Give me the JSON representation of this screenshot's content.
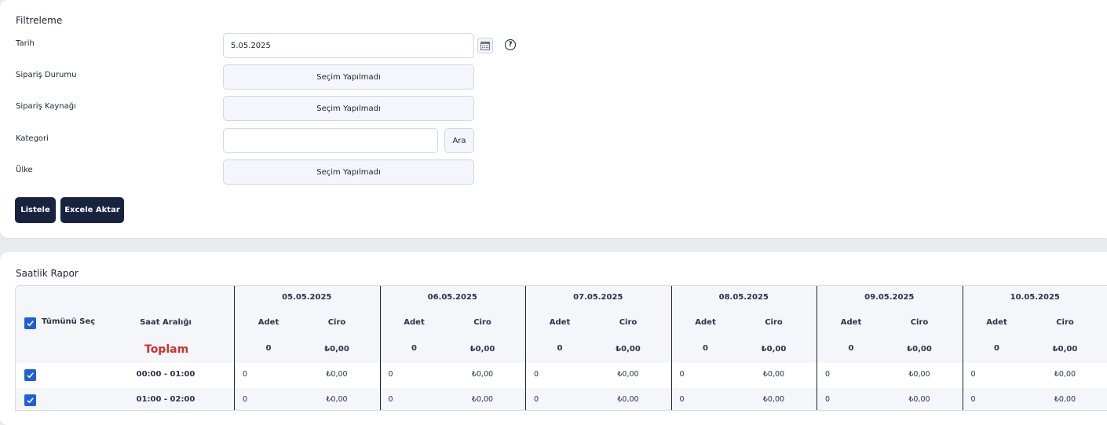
{
  "filter": {
    "title": "Filtreleme",
    "date_label": "Tarih",
    "date_value": "5.05.2025",
    "status_label": "Sipariş Durumu",
    "status_value": "Seçim Yapılmadı",
    "source_label": "Sipariş Kaynağı",
    "source_value": "Seçim Yapılmadı",
    "category_label": "Kategori",
    "category_value": "",
    "search_button": "Ara",
    "country_label": "Ülke",
    "country_value": "Seçim Yapılmadı",
    "list_button": "Listele",
    "excel_button": "Excele Aktar",
    "help_icon": "question-icon",
    "calendar_icon": "calendar-icon"
  },
  "report": {
    "title": "Saatlik Rapor",
    "select_all_label": "Tümünü Seç",
    "select_all_checked": true,
    "range_header": "Saat Aralığı",
    "total_label": "Toplam",
    "adet_header": "Adet",
    "ciro_header": "Ciro",
    "dates": [
      {
        "date": "05.05.2025",
        "total_adet": "0",
        "total_ciro": "₺0,00"
      },
      {
        "date": "06.05.2025",
        "total_adet": "0",
        "total_ciro": "₺0,00"
      },
      {
        "date": "07.05.2025",
        "total_adet": "0",
        "total_ciro": "₺0,00"
      },
      {
        "date": "08.05.2025",
        "total_adet": "0",
        "total_ciro": "₺0,00"
      },
      {
        "date": "09.05.2025",
        "total_adet": "0",
        "total_ciro": "₺0,00"
      },
      {
        "date": "10.05.2025",
        "total_adet": "0",
        "total_ciro": "₺0,00"
      }
    ],
    "rows": [
      {
        "range": "00:00 - 01:00",
        "checked": true,
        "values": [
          [
            "0",
            "₺0,00"
          ],
          [
            "0",
            "₺0,00"
          ],
          [
            "0",
            "₺0,00"
          ],
          [
            "0",
            "₺0,00"
          ],
          [
            "0",
            "₺0,00"
          ],
          [
            "0",
            "₺0,00"
          ]
        ]
      },
      {
        "range": "01:00 - 02:00",
        "checked": true,
        "values": [
          [
            "0",
            "₺0,00"
          ],
          [
            "0",
            "₺0,00"
          ],
          [
            "0",
            "₺0,00"
          ],
          [
            "0",
            "₺0,00"
          ],
          [
            "0",
            "₺0,00"
          ],
          [
            "0",
            "₺0,00"
          ]
        ]
      }
    ],
    "accent_color": "#1f5fd6",
    "total_color": "#d0312d",
    "button_color": "#18233f"
  }
}
